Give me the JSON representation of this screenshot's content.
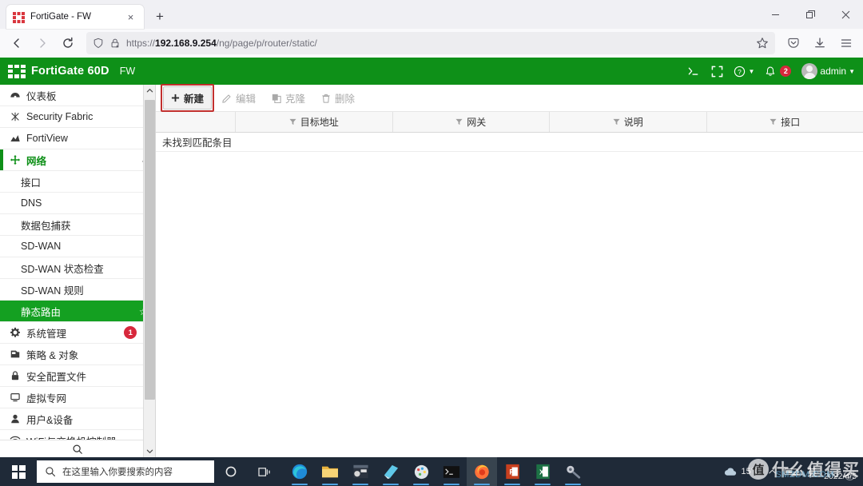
{
  "browser": {
    "tab": {
      "title": "FortiGate - FW",
      "favicon": "fortinet-icon",
      "close": "×"
    },
    "newtab_label": "+",
    "window_controls": {
      "minimize": "–",
      "maximize": "❐",
      "close": "✕"
    },
    "nav": {
      "back": "←",
      "forward": "→",
      "reload": "⟳",
      "shield_icon": "shield-icon",
      "lock_icon": "lock-warning-icon",
      "url_prefix": "https://",
      "url_host": "192.168.9.254",
      "url_path": "/ng/page/p/router/static/",
      "bookmark_icon": "star-icon",
      "pocket_icon": "pocket-icon",
      "downloads_icon": "download-icon",
      "menu_icon": "hamburger-menu-icon"
    }
  },
  "fortigate": {
    "header": {
      "model": "FortiGate 60D",
      "hostname": "FW",
      "cli_icon": ">_",
      "fullscreen_icon": "fullscreen-icon",
      "help_icon": "?",
      "alert_count": "2",
      "user": "admin"
    },
    "sidebar": {
      "items": [
        {
          "label": "仪表板",
          "icon": "dashboard-icon",
          "chevron": "›",
          "type": "group"
        },
        {
          "label": "Security Fabric",
          "icon": "fabric-icon",
          "chevron": "›",
          "type": "group"
        },
        {
          "label": "FortiView",
          "icon": "chart-icon",
          "chevron": "›",
          "type": "group"
        },
        {
          "label": "网络",
          "icon": "network-icon",
          "chevron": "⌄",
          "type": "group-open"
        },
        {
          "label": "接口",
          "type": "child"
        },
        {
          "label": "DNS",
          "type": "child"
        },
        {
          "label": "数据包捕获",
          "type": "child"
        },
        {
          "label": "SD-WAN",
          "type": "child"
        },
        {
          "label": "SD-WAN 状态检查",
          "type": "child"
        },
        {
          "label": "SD-WAN 规则",
          "type": "child"
        },
        {
          "label": "静态路由",
          "type": "child-selected",
          "star": "☆"
        },
        {
          "label": "系统管理",
          "icon": "gear-icon",
          "chevron": "›",
          "badge": "1",
          "type": "group"
        },
        {
          "label": "策略 & 对象",
          "icon": "policy-icon",
          "chevron": "›",
          "type": "group"
        },
        {
          "label": "安全配置文件",
          "icon": "lock-icon",
          "chevron": "›",
          "type": "group"
        },
        {
          "label": "虚拟专网",
          "icon": "monitor-icon",
          "chevron": "›",
          "type": "group"
        },
        {
          "label": "用户&设备",
          "icon": "user-icon",
          "chevron": "›",
          "type": "group"
        },
        {
          "label": "WiFi与交换机控制器",
          "icon": "wifi-icon",
          "chevron": "›",
          "type": "group"
        }
      ],
      "search_icon": "search-icon",
      "scroll_up": "⌃",
      "scroll_down": "⌄"
    },
    "toolbar": {
      "create_new": "新建",
      "create_new_icon": "plus-icon",
      "edit": "编辑",
      "edit_icon": "pencil-icon",
      "clone": "克隆",
      "clone_icon": "copy-icon",
      "delete": "删除",
      "delete_icon": "trash-icon"
    },
    "table": {
      "columns": [
        "",
        "目标地址",
        "网关",
        "说明",
        "接口"
      ],
      "filter_icon": "funnel-icon",
      "empty_message": "未找到匹配条目",
      "rows": []
    }
  },
  "taskbar": {
    "start_icon": "windows-logo-icon",
    "search_placeholder": "在这里输入你要搜索的内容",
    "search_icon": "search-icon",
    "cortana_icon": "cortana-circle-icon",
    "taskview_icon": "task-view-icon",
    "apps": [
      {
        "name": "edge-icon"
      },
      {
        "name": "file-explorer-icon"
      },
      {
        "name": "window-app-icon"
      },
      {
        "name": "notepad-icon"
      },
      {
        "name": "paint-icon"
      },
      {
        "name": "terminal-icon"
      },
      {
        "name": "firefox-icon",
        "active": true
      },
      {
        "name": "powerpoint-icon"
      },
      {
        "name": "excel-icon"
      },
      {
        "name": "tools-icon"
      }
    ],
    "weather": "15°C",
    "weather_icon": "cloud-icon",
    "tray_expand": "⌃",
    "date": "2022/4/5",
    "watermark": {
      "mark": "值",
      "text": "什么值得买",
      "sub": "SMZDM.COM",
      "num": "5"
    }
  },
  "colors": {
    "fortinet_green": "#0e9018",
    "selected_green": "#14a021",
    "badge_red": "#d7283c",
    "highlight_red": "#c2302e",
    "taskbar": "#1f2a38"
  }
}
